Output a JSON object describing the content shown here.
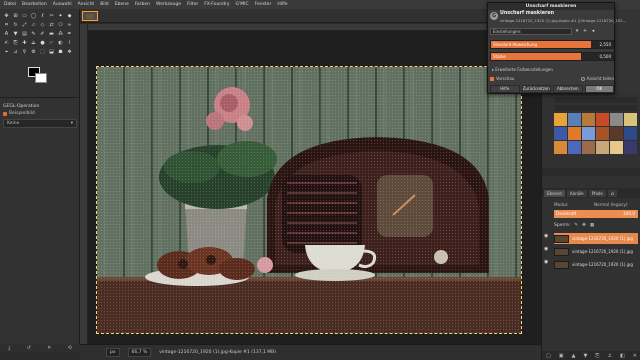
{
  "menu": [
    "Datei",
    "Bearbeiten",
    "Auswahl",
    "Ansicht",
    "Bild",
    "Ebene",
    "Farben",
    "Werkzeuge",
    "Filter",
    "FX-Foundry",
    "G'MIC",
    "Fenster",
    "Hilfe"
  ],
  "tool_options": {
    "title": "GEGL-Operation",
    "checkbox_label": "Beispielbild",
    "select_value": "Keine"
  },
  "dialog": {
    "window_title": "Unscharf maskieren",
    "heading": "Unscharf maskieren",
    "subtitle": "vintage-1216720_1920 (1).jpg-Kopie-#1 ([Vintage-1216720_192...",
    "presets_label": "Einstellungen:",
    "radius_label": "Standard-Abweichung",
    "radius_value": "2,550",
    "radius_fraction": 0.82,
    "amount_label": "Stärke",
    "amount_value": "0,500",
    "amount_fraction": 0.74,
    "advanced_label": "Erweiterte Farbeinstellungen",
    "preview_label": "Vorschau",
    "split_label": "Ansicht teilen",
    "buttons": {
      "help": "Hilfe",
      "reset": "Zurücksetzen",
      "cancel": "Abbrechen",
      "ok": "OK"
    }
  },
  "status": {
    "unit": "px",
    "zoom": "66,7 %",
    "file": "vintage-1216720_1920 (1).jpg-Kopie #1 (137,1 MB)"
  },
  "layers_panel": {
    "tabs": [
      "Ebenen",
      "Kanäle",
      "Pfade",
      ""
    ],
    "mode_label": "Modus",
    "mode_value": "Normal (legacy)",
    "opacity_label": "Deckkraft",
    "opacity_value": "100,0",
    "lock_label": "Sperre:",
    "layers": [
      {
        "name": "vintage-1216720_1920 (1).jpg",
        "selected": true
      },
      {
        "name": "vintage-1216720_1920 (1).jpg",
        "selected": false
      },
      {
        "name": "vintage-1216720_1920 (1).jpg",
        "selected": false
      }
    ]
  },
  "colors": {
    "accent": "#e8743a",
    "panel": "#313131",
    "canvas_bg": "#1f1f1f"
  }
}
